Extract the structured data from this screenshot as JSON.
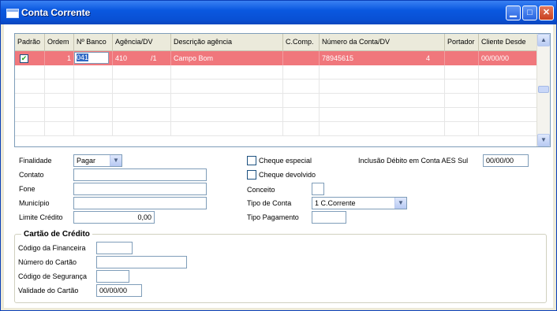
{
  "window": {
    "title": "Conta Corrente",
    "buttons": [
      "minimize",
      "maximize",
      "close"
    ]
  },
  "grid": {
    "columns": [
      "Padrão",
      "Ordem",
      "Nº Banco",
      "Agência/DV",
      "Descrição agência",
      "C.Comp.",
      "Número da Conta/DV",
      "Portador",
      "Cliente Desde"
    ],
    "rows": [
      {
        "padrao_checked": true,
        "ordem": "1",
        "banco": "041",
        "agencia": "410",
        "agencia_dv": "/1",
        "descricao": "Campo Bom",
        "ccomp": "",
        "conta": "78945615",
        "conta_dv": "4",
        "portador": "",
        "cliente_desde": "00/00/00"
      }
    ],
    "empty_rows": 5
  },
  "form": {
    "finalidade": {
      "label": "Finalidade",
      "value": "Pagar"
    },
    "contato": {
      "label": "Contato",
      "value": ""
    },
    "fone": {
      "label": "Fone",
      "value": ""
    },
    "municipio": {
      "label": "Município",
      "value": ""
    },
    "limite": {
      "label": "Limite Crédito",
      "value": "0,00"
    },
    "cheque_especial": {
      "label": "Cheque especial",
      "checked": false
    },
    "cheque_devolvido": {
      "label": "Cheque devolvido",
      "checked": false
    },
    "conceito": {
      "label": "Conceito",
      "value": ""
    },
    "tipo_conta": {
      "label": "Tipo de Conta",
      "value": "1 C.Corrente"
    },
    "tipo_pagamento": {
      "label": "Tipo Pagamento",
      "value": ""
    },
    "inclusao": {
      "label": "Inclusão Débito em Conta AES Sul",
      "value": "00/00/00"
    }
  },
  "cartao": {
    "title": "Cartão de Crédito",
    "codigo_financeira": {
      "label": "Código da Financeira",
      "value": ""
    },
    "numero_cartao": {
      "label": "Número do Cartão",
      "value": ""
    },
    "codigo_seguranca": {
      "label": "Código de Segurança",
      "value": ""
    },
    "validade": {
      "label": "Validade do Cartão",
      "value": "00/00/00"
    }
  },
  "colors": {
    "titlebar": "#0a58e0",
    "selected_row": "#f0777c",
    "border": "#7f9db9"
  }
}
